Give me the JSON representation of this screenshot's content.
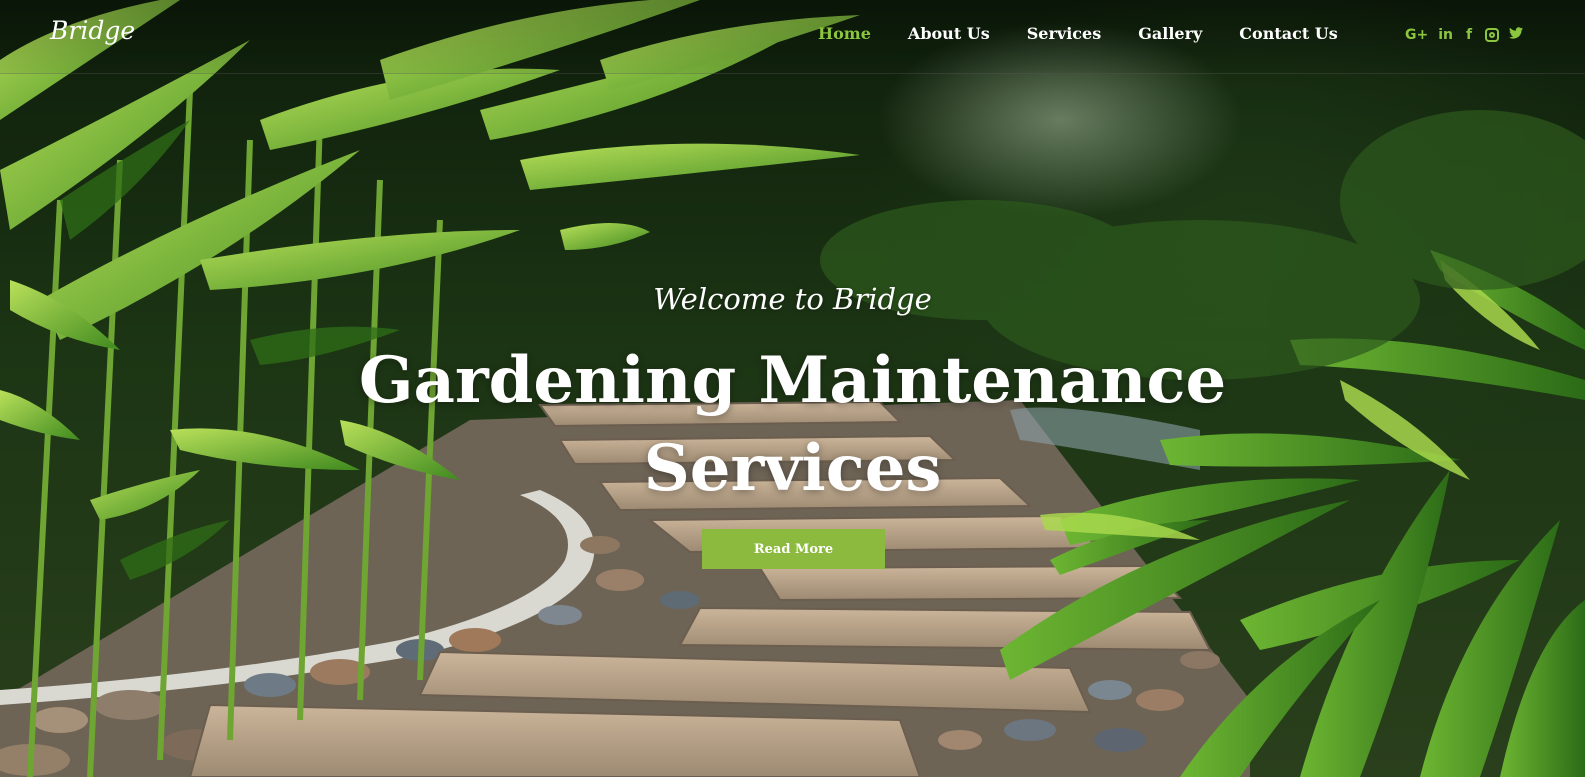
{
  "brand": {
    "logo": "Bridge"
  },
  "nav": {
    "items": [
      {
        "label": "Home",
        "active": true
      },
      {
        "label": "About Us",
        "active": false
      },
      {
        "label": "Services",
        "active": false
      },
      {
        "label": "Gallery",
        "active": false
      },
      {
        "label": "Contact Us",
        "active": false
      }
    ]
  },
  "social": {
    "icons": [
      "google-plus-icon",
      "linkedin-icon",
      "facebook-icon",
      "instagram-icon",
      "twitter-icon"
    ],
    "google_plus": "G+",
    "linkedin": "in",
    "facebook": "f",
    "twitter": "🐦"
  },
  "hero": {
    "welcome": "Welcome to Bridge",
    "title_line1": "Gardening Maintenance",
    "title_line2": "Services",
    "cta_label": "Read More"
  },
  "colors": {
    "accent": "#8cc63f",
    "button": "#8cba3f",
    "text": "#ffffff"
  }
}
